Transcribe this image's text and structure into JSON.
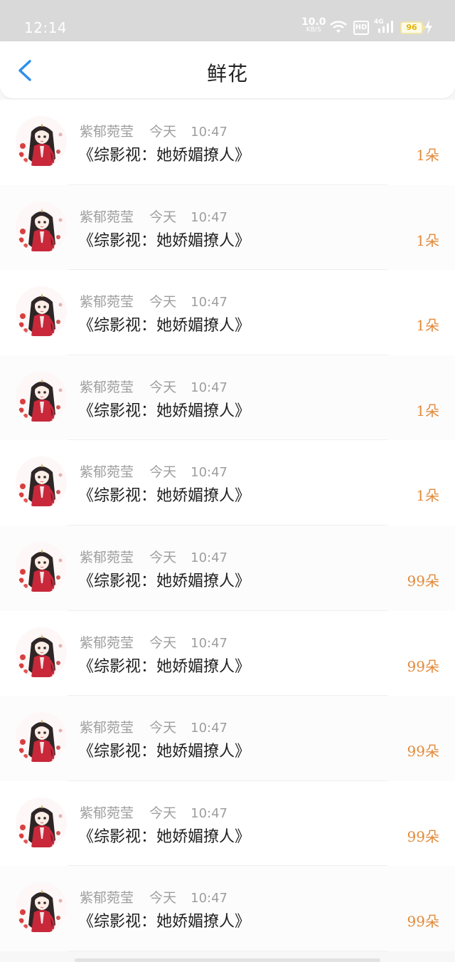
{
  "status_bar": {
    "time": "12:14",
    "net_speed_value": "10.0",
    "net_speed_unit": "KB/S",
    "hd_label": "HD",
    "signal_label": "4G",
    "battery_level": "96",
    "icons": [
      "wifi-icon",
      "hd-icon",
      "signal-icon",
      "battery-icon",
      "charging-icon"
    ]
  },
  "header": {
    "title": "鲜花",
    "back_icon": "chevron-left-icon",
    "accent_color": "#2f8fe6"
  },
  "items": [
    {
      "user": "紫郁菀莹",
      "day": "今天",
      "time": "10:47",
      "book": "《综影视：她娇媚撩人》",
      "count": "1朵"
    },
    {
      "user": "紫郁菀莹",
      "day": "今天",
      "time": "10:47",
      "book": "《综影视：她娇媚撩人》",
      "count": "1朵"
    },
    {
      "user": "紫郁菀莹",
      "day": "今天",
      "time": "10:47",
      "book": "《综影视：她娇媚撩人》",
      "count": "1朵"
    },
    {
      "user": "紫郁菀莹",
      "day": "今天",
      "time": "10:47",
      "book": "《综影视：她娇媚撩人》",
      "count": "1朵"
    },
    {
      "user": "紫郁菀莹",
      "day": "今天",
      "time": "10:47",
      "book": "《综影视：她娇媚撩人》",
      "count": "1朵"
    },
    {
      "user": "紫郁菀莹",
      "day": "今天",
      "time": "10:47",
      "book": "《综影视：她娇媚撩人》",
      "count": "99朵"
    },
    {
      "user": "紫郁菀莹",
      "day": "今天",
      "time": "10:47",
      "book": "《综影视：她娇媚撩人》",
      "count": "99朵"
    },
    {
      "user": "紫郁菀莹",
      "day": "今天",
      "time": "10:47",
      "book": "《综影视：她娇媚撩人》",
      "count": "99朵"
    },
    {
      "user": "紫郁菀莹",
      "day": "今天",
      "time": "10:47",
      "book": "《综影视：她娇媚撩人》",
      "count": "99朵"
    },
    {
      "user": "紫郁菀莹",
      "day": "今天",
      "time": "10:47",
      "book": "《综影视：她娇媚撩人》",
      "count": "99朵"
    }
  ],
  "colors": {
    "count_color": "#e28a3c",
    "meta_color": "#9e9e9e"
  }
}
